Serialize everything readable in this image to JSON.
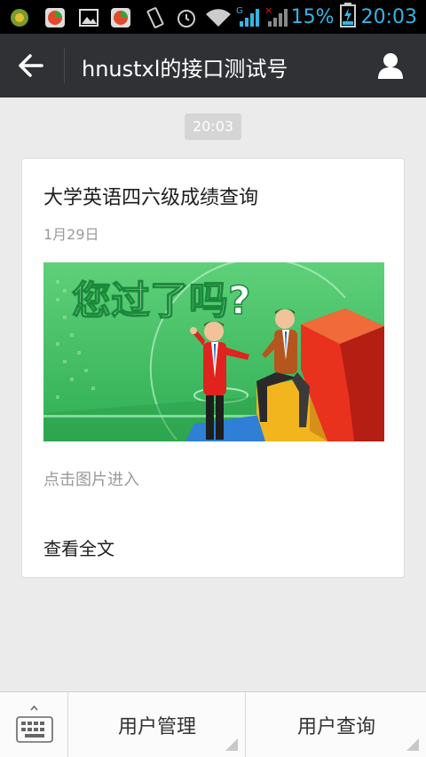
{
  "status_bar": {
    "battery_percent": "15%",
    "time": "20:03",
    "network_label": "G",
    "icons": [
      "app-icon",
      "app-icon-2",
      "image-icon",
      "app-icon-3",
      "vibrate-icon",
      "alarm-icon",
      "wifi-icon",
      "signal-icon",
      "signal-off-icon",
      "battery-charging-icon"
    ]
  },
  "header": {
    "title": "hnustxl的接口测试号"
  },
  "chat": {
    "timestamp": "20:03"
  },
  "card": {
    "title": "大学英语四六级成绩查询",
    "date": "1月29日",
    "image_caption": "您过了吗?",
    "hint": "点击图片进入",
    "read_more": "查看全文"
  },
  "bottom_menu": {
    "items": [
      {
        "label": "用户管理"
      },
      {
        "label": "用户查询"
      }
    ]
  },
  "colors": {
    "status_accent": "#34b5e5",
    "header_bg": "#2f3135",
    "page_bg": "#ebebeb"
  }
}
